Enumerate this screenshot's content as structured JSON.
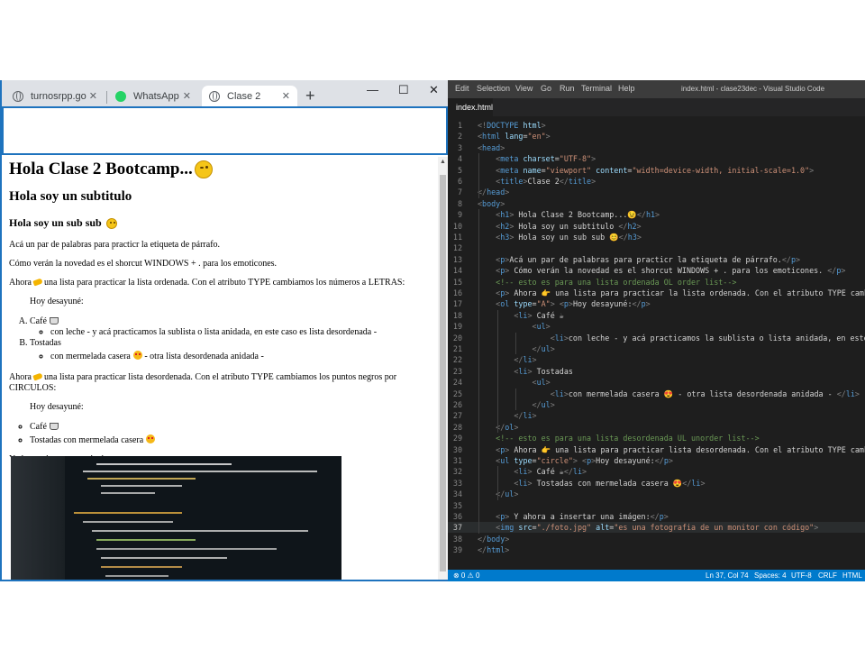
{
  "browser": {
    "tabs": [
      {
        "label": "turnosrpp.gob",
        "icon": "globe-icon"
      },
      {
        "label": "WhatsApp",
        "icon": "whatsapp-icon"
      },
      {
        "label": "Clase 2",
        "icon": "globe-icon",
        "active": true
      }
    ],
    "page": {
      "h1": "Hola Clase 2 Bootcamp...",
      "h2": "Hola soy un subtitulo",
      "h3": "Hola soy un sub sub",
      "p1": "Acá un par de palabras para practicr la etiqueta de párrafo.",
      "p2": "Cómo verán la novedad es el shorcut WINDOWS + . para los emoticones.",
      "p3_a": "Ahora",
      "p3_b": "una lista para practicar la lista ordenada. Con el atributo TYPE cambiamos los números a LETRAS:",
      "desayune": "Hoy desayuné:",
      "cafe": "Café",
      "con_leche": "con leche - y acá practicamos la sublista o lista anidada, en este caso es lista desordenada -",
      "tostadas": "Tostadas",
      "mermelada_a": "con mermelada casera",
      "mermelada_b": "- otra lista desordenada anidada -",
      "p4_a": "Ahora",
      "p4_b": "una lista para practicar lista desordenada. Con el atributo TYPE cambiamos los puntos negros por CIRCULOS:",
      "desayune2": "Hoy desayuné:",
      "cafe2": "Café",
      "tostadas2": "Tostadas con mermelada casera",
      "p5": "Y ahora a insertar una imágen:"
    }
  },
  "vscode": {
    "menu": [
      "Edit",
      "Selection",
      "View",
      "Go",
      "Run",
      "Terminal",
      "Help"
    ],
    "window_title": "index.html - clase23dec - Visual Studio Code",
    "file_tab": "index.html",
    "lines": [
      {
        "n": "1",
        "code": "<!DOCTYPE html>"
      },
      {
        "n": "2",
        "code": "<html lang=\"en\">"
      },
      {
        "n": "3",
        "code": "<head>"
      },
      {
        "n": "4",
        "code": "    <meta charset=\"UTF-8\">"
      },
      {
        "n": "5",
        "code": "    <meta name=\"viewport\" content=\"width=device-width, initial-scale=1.0\">"
      },
      {
        "n": "6",
        "code": "    <title>Clase 2</title>"
      },
      {
        "n": "7",
        "code": "</head>"
      },
      {
        "n": "8",
        "code": "<body>"
      },
      {
        "n": "9",
        "code": "    <h1> Hola Clase 2 Bootcamp...😉</h1>"
      },
      {
        "n": "10",
        "code": "    <h2> Hola soy un subtitulo </h2>"
      },
      {
        "n": "11",
        "code": "    <h3> Hola soy un sub sub 😊</h3>"
      },
      {
        "n": "12",
        "code": ""
      },
      {
        "n": "13",
        "code": "    <p>Acá un par de palabras para practicr la etiqueta de párrafo.</p>"
      },
      {
        "n": "14",
        "code": "    <p> Cómo verán la novedad es el shorcut WINDOWS + . para los emoticones. </p>"
      },
      {
        "n": "15",
        "code": "    <!-- esto es para una lista ordenada OL order list-->"
      },
      {
        "n": "16",
        "code": "    <p> Ahora 👉 una lista para practicar la lista ordenada. Con el atributo TYPE cambiam"
      },
      {
        "n": "17",
        "code": "    <ol type=\"A\"> <p>Hoy desayuné:</p>"
      },
      {
        "n": "18",
        "code": "        <li> Café ☕"
      },
      {
        "n": "19",
        "code": "            <ul>"
      },
      {
        "n": "20",
        "code": "                <li>con leche - y acá practicamos la sublista o lista anidada, en este c"
      },
      {
        "n": "21",
        "code": "            </ul>"
      },
      {
        "n": "22",
        "code": "        </li>"
      },
      {
        "n": "23",
        "code": "        <li> Tostadas"
      },
      {
        "n": "24",
        "code": "            <ul>"
      },
      {
        "n": "25",
        "code": "                <li>con mermelada casera 😍 - otra lista desordenada anidada - </li>"
      },
      {
        "n": "26",
        "code": "            </ul>"
      },
      {
        "n": "27",
        "code": "        </li>"
      },
      {
        "n": "28",
        "code": "    </ol>"
      },
      {
        "n": "29",
        "code": "    <!-- esto es para una lista desordenada UL unorder list-->"
      },
      {
        "n": "30",
        "code": "    <p> Ahora 👉 una lista para practicar lista desordenada. Con el atributo TYPE cambia"
      },
      {
        "n": "31",
        "code": "    <ul type=\"circle\"> <p>Hoy desayuné:</p>"
      },
      {
        "n": "32",
        "code": "        <li> Café ☕</li>"
      },
      {
        "n": "33",
        "code": "        <li> Tostadas con mermelada casera 😍</li>"
      },
      {
        "n": "34",
        "code": "    </ul>"
      },
      {
        "n": "35",
        "code": ""
      },
      {
        "n": "36",
        "code": "    <p> Y ahora a insertar una imágen:</p>"
      },
      {
        "n": "37",
        "code": "    <img src=\"./foto.jpg\" alt=\"es una fotografia de un monitor con código\">"
      },
      {
        "n": "38",
        "code": "</body>"
      },
      {
        "n": "39",
        "code": "</html>"
      }
    ],
    "status": {
      "problems": "⊗ 0 ⚠ 0",
      "position": "Ln 37, Col 74",
      "spaces": "Spaces: 4",
      "encoding": "UTF-8",
      "eol": "CRLF",
      "language": "HTML"
    }
  },
  "colors": {
    "accent": "#1e73be",
    "vscode_bg": "#1e1e1e",
    "statusbar": "#007acc"
  }
}
